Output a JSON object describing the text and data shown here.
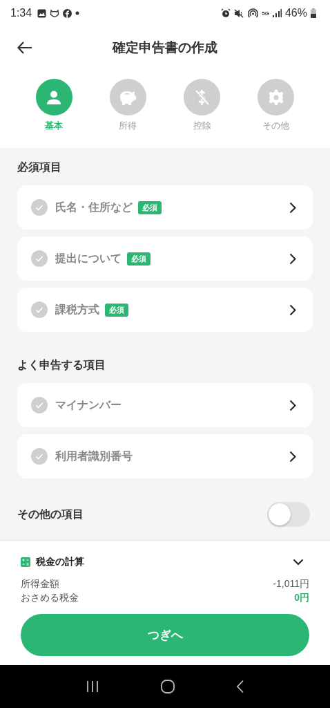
{
  "status_bar": {
    "time": "1:34",
    "network": "5G",
    "battery": "46%"
  },
  "header": {
    "title": "確定申告書の作成"
  },
  "steps": [
    {
      "label": "基本",
      "kind": "person",
      "selected": true
    },
    {
      "label": "所得",
      "kind": "piggy",
      "selected": false
    },
    {
      "label": "控除",
      "kind": "deduction",
      "selected": false
    },
    {
      "label": "その他",
      "kind": "gear",
      "selected": false
    }
  ],
  "sections": [
    {
      "title": "必須項目",
      "items": [
        {
          "label": "氏名・住所など",
          "badge": "必須",
          "completed": false
        },
        {
          "label": "提出について",
          "badge": "必須",
          "completed": false
        },
        {
          "label": "課税方式",
          "badge": "必須",
          "completed": false
        }
      ]
    },
    {
      "title": "よく申告する項目",
      "items": [
        {
          "label": "マイナンバー",
          "completed": false
        },
        {
          "label": "利用者識別番号",
          "completed": false
        }
      ]
    }
  ],
  "other_items": {
    "label": "その他の項目",
    "on": false
  },
  "tax_summary": {
    "title": "税金の計算",
    "expanded": false,
    "rows": [
      {
        "label": "所得金額",
        "value": "-1,011円",
        "highlight": false
      },
      {
        "label": "おさめる税金",
        "value": "0円",
        "highlight": true
      }
    ]
  },
  "next_button": "つぎへ"
}
